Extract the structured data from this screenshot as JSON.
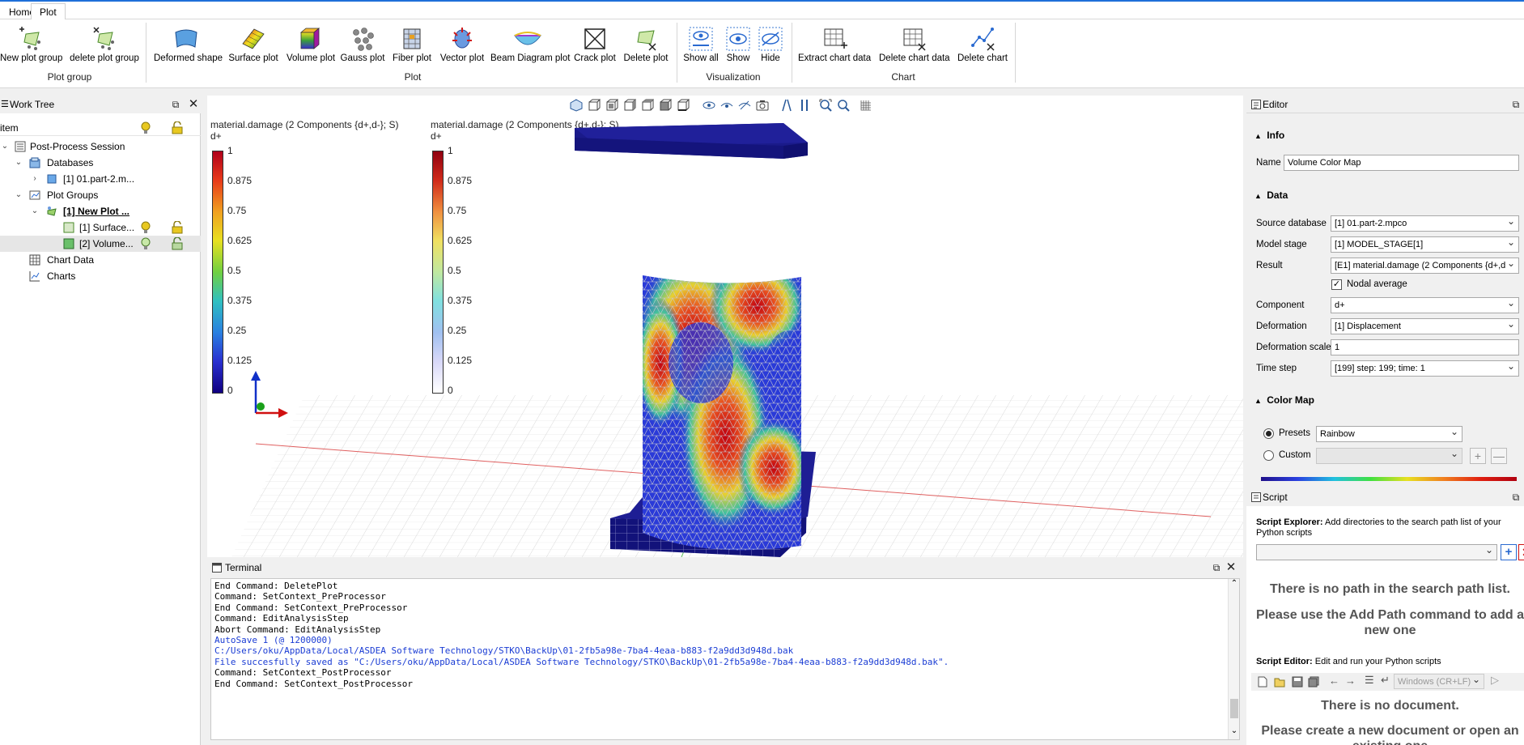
{
  "ribbon": {
    "tabs": [
      "Home",
      "Plot"
    ],
    "active_tab": "Plot",
    "groups": {
      "plot_group": "Plot group",
      "plot": "Plot",
      "visualization": "Visualization",
      "chart": "Chart"
    },
    "buttons": {
      "new_plot_group": "New plot group",
      "delete_plot_group": "delete plot group",
      "deformed_shape": "Deformed shape",
      "surface_plot": "Surface plot",
      "volume_plot": "Volume plot",
      "gauss_plot": "Gauss plot",
      "fiber_plot": "Fiber plot",
      "vector_plot": "Vector plot",
      "beam_diagram_plot": "Beam Diagram plot",
      "crack_plot": "Crack plot",
      "delete_plot": "Delete plot",
      "show_all": "Show all",
      "show": "Show",
      "hide": "Hide",
      "extract_chart_data": "Extract chart data",
      "delete_chart_data": "Delete chart data",
      "delete_chart": "Delete chart"
    }
  },
  "worktree": {
    "title": "Work Tree",
    "column_header": "item",
    "items": {
      "session": "Post-Process Session",
      "databases": "Databases",
      "database_1": "[1] 01.part-2.m...",
      "plot_groups": "Plot Groups",
      "plot_group_1": "[1] New Plot ...",
      "surface": "[1] Surface...",
      "volume": "[2] Volume...",
      "chart_data": "Chart Data",
      "charts": "Charts"
    }
  },
  "viewport": {
    "legend_left": {
      "title": "material.damage (2 Components {d+,d-}; S)",
      "component": "d+",
      "ticks": [
        "1",
        "0.875",
        "0.75",
        "0.625",
        "0.5",
        "0.375",
        "0.25",
        "0.125",
        "0"
      ]
    },
    "legend_right": {
      "title": "material.damage (2 Components {d+,d-}; S)",
      "component": "d+",
      "ticks": [
        "1",
        "0.875",
        "0.75",
        "0.625",
        "0.5",
        "0.375",
        "0.25",
        "0.125",
        "0"
      ]
    },
    "colors": {
      "deep_blue": "#1a1a8a",
      "mesh": "#c8c8c8",
      "axis_x": "#d01010",
      "axis_y": "#1aa01a",
      "axis_z": "#1030c8"
    }
  },
  "terminal": {
    "title": "Terminal",
    "lines": [
      {
        "text": "End Command: DeletePlot",
        "kind": "normal"
      },
      {
        "text": "Command: SetContext_PreProcessor",
        "kind": "normal"
      },
      {
        "text": "End Command: SetContext_PreProcessor",
        "kind": "normal"
      },
      {
        "text": "Command: EditAnalysisStep",
        "kind": "normal"
      },
      {
        "text": "Abort Command: EditAnalysisStep",
        "kind": "normal"
      },
      {
        "text": "AutoSave 1 (@ 1200000)",
        "kind": "blue"
      },
      {
        "text": "C:/Users/oku/AppData/Local/ASDEA Software Technology/STKO\\BackUp\\01-2fb5a98e-7ba4-4eaa-b883-f2a9dd3d948d.bak",
        "kind": "blue"
      },
      {
        "text": "File succesfully saved as \"C:/Users/oku/AppData/Local/ASDEA Software Technology/STKO\\BackUp\\01-2fb5a98e-7ba4-4eaa-b883-f2a9dd3d948d.bak\".",
        "kind": "blue"
      },
      {
        "text": "Command: SetContext_PostProcessor",
        "kind": "normal"
      },
      {
        "text": "End Command: SetContext_PostProcessor",
        "kind": "normal"
      }
    ]
  },
  "editor": {
    "title": "Editor",
    "info_section": "Info",
    "name_label": "Name",
    "name_value": "Volume Color Map",
    "data_section": "Data",
    "source_database_label": "Source database",
    "source_database_value": "[1] 01.part-2.mpco",
    "model_stage_label": "Model stage",
    "model_stage_value": "[1] MODEL_STAGE[1]",
    "result_label": "Result",
    "result_value": "[E1] material.damage (2 Components {d+,d",
    "nodal_average_label": "Nodal average",
    "nodal_average_checked": true,
    "component_label": "Component",
    "component_value": "d+",
    "deformation_label": "Deformation",
    "deformation_value": "[1] Displacement",
    "deformation_scale_label": "Deformation scale",
    "deformation_scale_value": "1",
    "time_step_label": "Time step",
    "time_step_value": "[199] step: 199; time: 1",
    "color_map_section": "Color Map",
    "presets_label": "Presets",
    "presets_value": "Rainbow",
    "custom_label": "Custom"
  },
  "script": {
    "title": "Script",
    "explorer_bold": "Script Explorer:",
    "explorer_text": "Add directories to the search path list of your Python scripts",
    "no_path_msg": "There is no path in the search path list.",
    "add_path_msg": "Please use the Add Path command to add a new one",
    "editor_bold": "Script Editor:",
    "editor_text": "Edit and run your Python scripts",
    "line_ending": "Windows (CR+LF)",
    "no_doc_msg": "There is no document.",
    "create_doc_msg": "Please create a new document or open an existing one"
  }
}
